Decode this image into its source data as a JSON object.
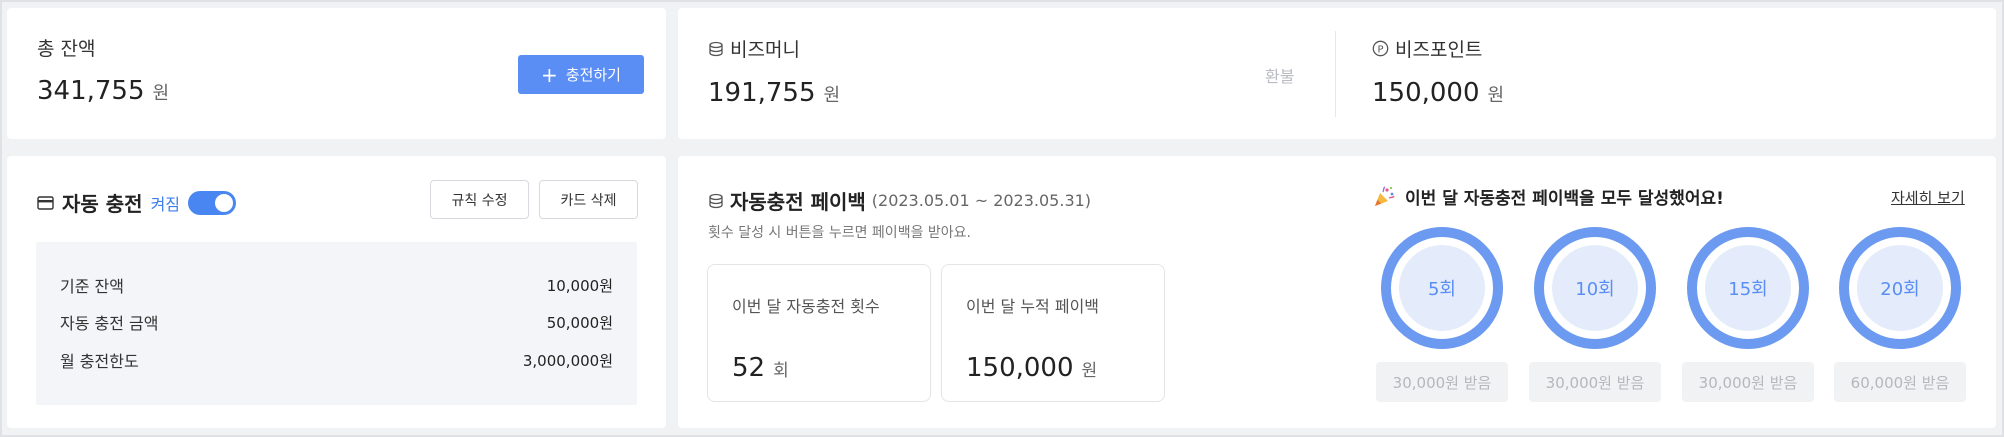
{
  "balance": {
    "total_label": "총 잔액",
    "total_value": "341,755",
    "unit": "원",
    "charge_button": "충전하기"
  },
  "bizmoney": {
    "label": "비즈머니",
    "value": "191,755",
    "unit": "원",
    "refund": "환불"
  },
  "bizpoint": {
    "label": "비즈포인트",
    "value": "150,000",
    "unit": "원"
  },
  "auto_charge": {
    "title": "자동 충전",
    "status": "켜짐",
    "toggle_on": true,
    "edit_rule_button": "규칙 수정",
    "delete_card_button": "카드 삭제",
    "rows": [
      {
        "label": "기준 잔액",
        "value": "10,000원"
      },
      {
        "label": "자동 충전 금액",
        "value": "50,000원"
      },
      {
        "label": "월 충전한도",
        "value": "3,000,000원"
      }
    ]
  },
  "payback": {
    "title": "자동충전 페이백",
    "period": "(2023.05.01 ~ 2023.05.31)",
    "subtitle": "횟수 달성 시 버튼을 누르면 페이백을 받아요.",
    "count_label": "이번 달 자동충전 횟수",
    "count_value": "52",
    "count_unit": "회",
    "sum_label": "이번 달 누적 페이백",
    "sum_value": "150,000",
    "sum_unit": "원",
    "milestone_title": "이번 달 자동충전 페이백을 모두 달성했어요!",
    "detail_link": "자세히 보기",
    "milestones": [
      {
        "label": "5회",
        "reward": "30,000원 받음"
      },
      {
        "label": "10회",
        "reward": "30,000원 받음"
      },
      {
        "label": "15회",
        "reward": "30,000원 받음"
      },
      {
        "label": "20회",
        "reward": "60,000원 받음"
      }
    ]
  },
  "colors": {
    "accent": "#5b8ef5",
    "ring": "#6b9af0",
    "ring_fill": "#e4ecfb"
  },
  "icons": [
    "plus-icon",
    "coin-stack-icon",
    "point-circle-icon",
    "card-icon",
    "party-popper-icon"
  ]
}
